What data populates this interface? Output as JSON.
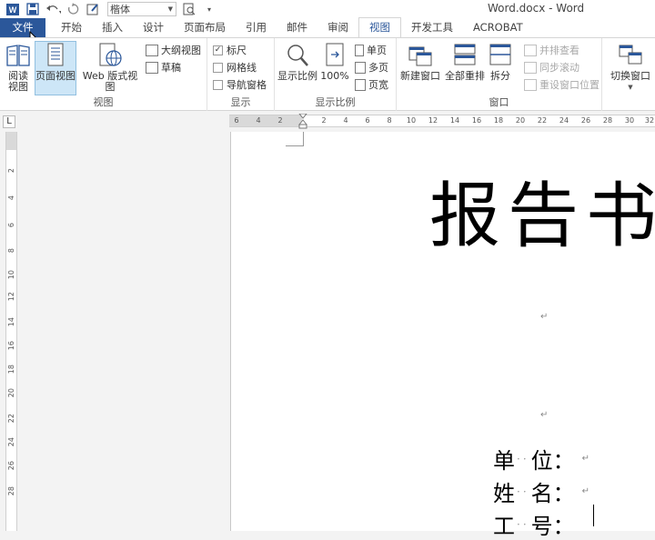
{
  "window": {
    "title": "Word.docx - Word"
  },
  "qat": {
    "font_name": "楷体"
  },
  "tabs": [
    "文件",
    "开始",
    "插入",
    "设计",
    "页面布局",
    "引用",
    "邮件",
    "审阅",
    "视图",
    "开发工具",
    "ACROBAT"
  ],
  "active_tab": "视图",
  "ribbon": {
    "views": {
      "label": "视图",
      "read_mode": "阅读\n视图",
      "print_layout": "页面视图",
      "web_layout": "Web 版式视图",
      "outline": "大纲视图",
      "draft": "草稿"
    },
    "show": {
      "label": "显示",
      "ruler": "标尺",
      "gridlines": "网格线",
      "nav_pane": "导航窗格",
      "ruler_checked": true,
      "gridlines_checked": false,
      "nav_pane_checked": false
    },
    "zoom": {
      "label": "显示比例",
      "zoom": "显示比例",
      "hundred": "100%",
      "one_page": "单页",
      "multi_page": "多页",
      "page_width": "页宽"
    },
    "window": {
      "label": "窗口",
      "new_window": "新建窗口",
      "arrange_all": "全部重排",
      "split": "拆分",
      "side_by_side": "并排查看",
      "sync_scroll": "同步滚动",
      "reset_pos": "重设窗口位置"
    },
    "switch": {
      "switch_windows": "切换窗口"
    }
  },
  "ruler": {
    "corner": "L",
    "h_numbers": [
      "6",
      "4",
      "2",
      "",
      "2",
      "4",
      "6",
      "8",
      "10",
      "12",
      "14",
      "16",
      "18",
      "20",
      "22",
      "24",
      "26",
      "28",
      "30",
      "32"
    ],
    "v_numbers": [
      "2",
      "4",
      "6",
      "8",
      "10",
      "12",
      "14",
      "16",
      "18",
      "20",
      "22",
      "24",
      "26",
      "28"
    ]
  },
  "document": {
    "title": "报告书",
    "fields": [
      {
        "label1": "单",
        "label2": "位",
        "colon": "："
      },
      {
        "label1": "姓",
        "label2": "名",
        "colon": "："
      },
      {
        "label1": "工",
        "label2": "号",
        "colon": "："
      }
    ],
    "para_mark": "↵"
  },
  "colors": {
    "accent": "#2b579a",
    "ribbon_bg": "#ffffff",
    "selected": "#cde6f7"
  }
}
